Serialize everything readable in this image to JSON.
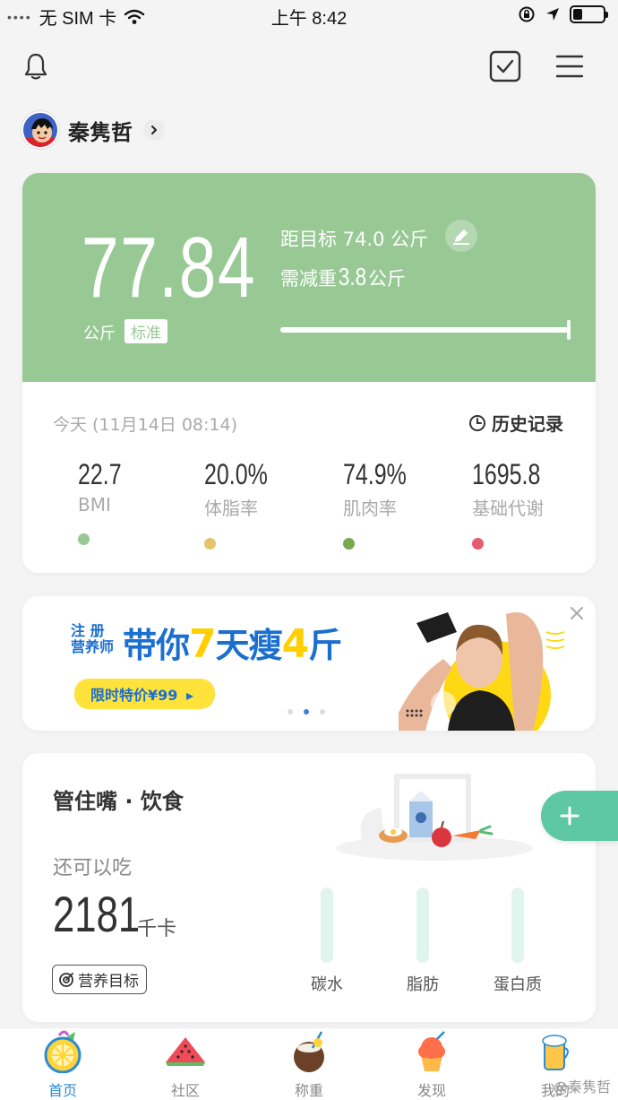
{
  "status_bar": {
    "signal_dots": "••••",
    "carrier": "无 SIM 卡",
    "time": "上午 8:42"
  },
  "user": {
    "name": "秦隽哲"
  },
  "weight": {
    "value": "77.84",
    "unit": "公斤",
    "status": "标准",
    "goal_text": "距目标 74.0 公斤",
    "need_prefix": "需减重",
    "need_value": "3.8",
    "need_unit": "公斤",
    "progress_percent": 100,
    "accent_color": "#98c995"
  },
  "measurement": {
    "time": "今天 (11月14日 08:14)",
    "history_label": "历史记录",
    "metrics": [
      {
        "value": "22.7",
        "label": "BMI",
        "color": "#98c995"
      },
      {
        "value": "20.0%",
        "label": "体脂率",
        "color": "#e6c46e"
      },
      {
        "value": "74.9%",
        "label": "肌肉率",
        "color": "#7aa84e"
      },
      {
        "value": "1695.8",
        "label": "基础代谢",
        "color": "#e45d6e"
      }
    ]
  },
  "banner": {
    "small_line1": "注  册",
    "small_line2": "营养师",
    "headline_a": "带你",
    "headline_b": "7",
    "headline_c": "天瘦",
    "headline_d": "4",
    "headline_e": "斤",
    "pill": "限时特价¥99",
    "page_index": 1,
    "page_count": 3
  },
  "diet": {
    "title": "管住嘴 · 饮食",
    "remain_label": "还可以吃",
    "kcal": "2181",
    "kcal_unit": "千卡",
    "nutrition_goal": "营养目标",
    "macros": [
      {
        "label": "碳水",
        "fill": 0
      },
      {
        "label": "脂肪",
        "fill": 0
      },
      {
        "label": "蛋白质",
        "fill": 0
      }
    ]
  },
  "tabs": [
    {
      "label": "首页",
      "icon": "lemon-icon",
      "active": true
    },
    {
      "label": "社区",
      "icon": "watermelon-icon",
      "active": false
    },
    {
      "label": "称重",
      "icon": "coconut-icon",
      "active": false
    },
    {
      "label": "发现",
      "icon": "cupcake-icon",
      "active": false
    },
    {
      "label": "我的",
      "icon": "drink-icon",
      "active": false
    }
  ],
  "watermark": "@秦隽哲"
}
